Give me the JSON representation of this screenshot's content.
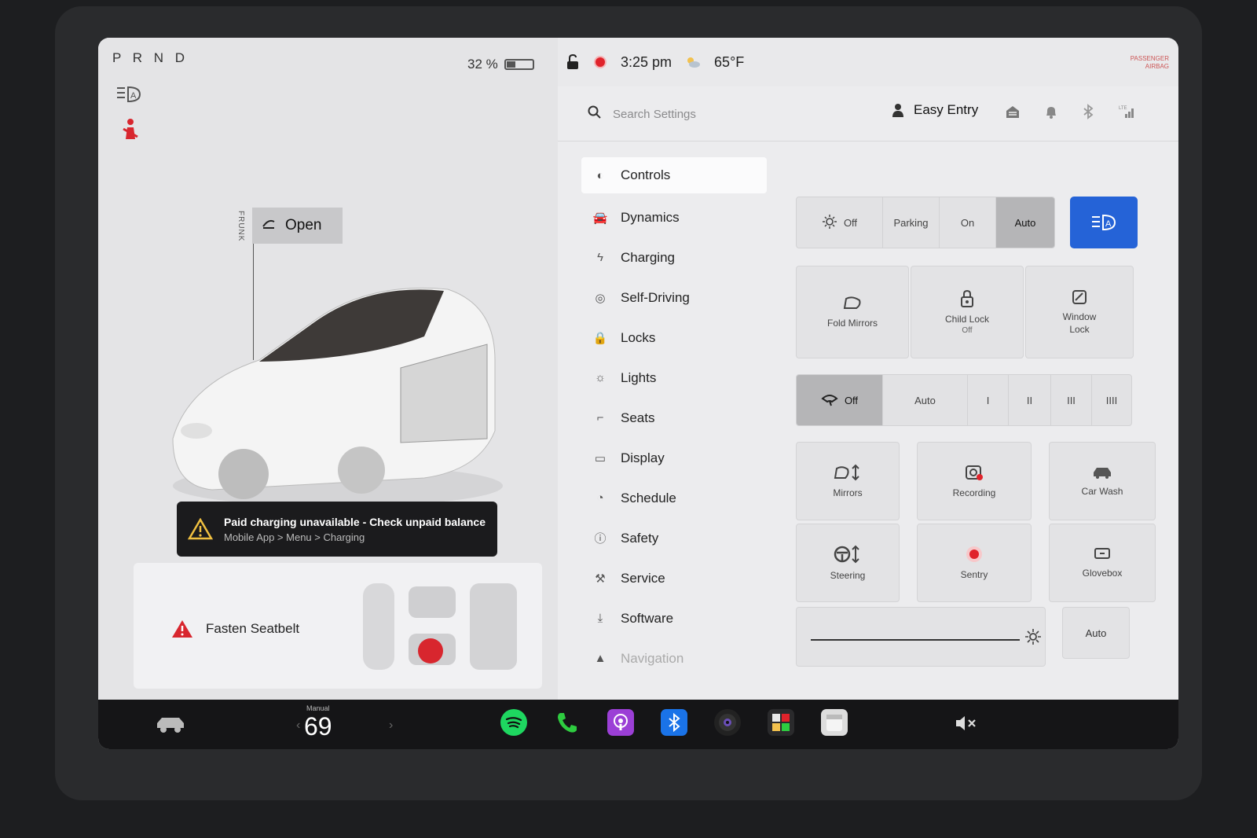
{
  "drive": {
    "gear_selector": "P R N D"
  },
  "battery": {
    "percent_text": "32 %",
    "level": 0.32
  },
  "status_bar": {
    "time": "3:25 pm",
    "temperature": "65°F",
    "airbag_line1": "PASSENGER",
    "airbag_line2": "AIRBAG"
  },
  "car_panel": {
    "frunk_label": "FRUNK",
    "frunk_button": "Open",
    "alert_title": "Paid charging unavailable - Check unpaid balance",
    "alert_path": "Mobile App > Menu > Charging",
    "seatbelt_warning": "Fasten Seatbelt"
  },
  "settings": {
    "search_placeholder": "Search Settings",
    "profile_name": "Easy Entry",
    "menu": [
      {
        "label": "Controls",
        "icon": "toggle-icon"
      },
      {
        "label": "Dynamics",
        "icon": "car-icon"
      },
      {
        "label": "Charging",
        "icon": "bolt-icon"
      },
      {
        "label": "Self-Driving",
        "icon": "steering-wheel-icon"
      },
      {
        "label": "Locks",
        "icon": "lock-icon"
      },
      {
        "label": "Lights",
        "icon": "light-icon"
      },
      {
        "label": "Seats",
        "icon": "seat-icon"
      },
      {
        "label": "Display",
        "icon": "display-icon"
      },
      {
        "label": "Schedule",
        "icon": "clock-icon"
      },
      {
        "label": "Safety",
        "icon": "safety-icon"
      },
      {
        "label": "Service",
        "icon": "wrench-icon"
      },
      {
        "label": "Software",
        "icon": "download-icon"
      },
      {
        "label": "Navigation",
        "icon": "navigation-icon"
      }
    ]
  },
  "controls": {
    "headlights": {
      "options": [
        "Off",
        "Parking",
        "On",
        "Auto"
      ],
      "selected": "Auto"
    },
    "fold_mirrors": "Fold Mirrors",
    "child_lock": "Child Lock",
    "child_lock_state": "Off",
    "window_lock_line1": "Window",
    "window_lock_line2": "Lock",
    "wipers": {
      "options": [
        "Off",
        "Auto",
        "I",
        "II",
        "III",
        "IIII"
      ],
      "selected": "Off"
    },
    "mirrors": "Mirrors",
    "recording": "Recording",
    "car_wash": "Car Wash",
    "steering": "Steering",
    "sentry": "Sentry",
    "glovebox": "Glovebox",
    "brightness_auto": "Auto"
  },
  "taskbar": {
    "temp_mode": "Manual",
    "temp_value": "69"
  },
  "colors": {
    "accent_blue": "#2563d7",
    "alert_red": "#e0232b",
    "spotify_green": "#1ed760",
    "phone_green": "#2ecc40",
    "podcast_purple": "#9b3fd6",
    "bluetooth_blue": "#1a73e8"
  }
}
